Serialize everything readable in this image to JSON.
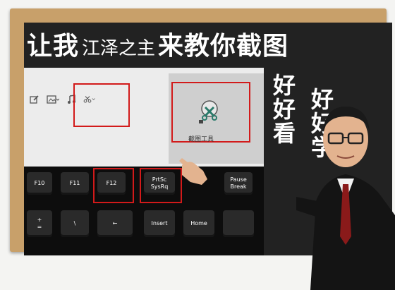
{
  "title": {
    "part1": "让我",
    "part2": "江泽之主",
    "part3": "来教你截图"
  },
  "side": {
    "left": "好好看",
    "right": "好好学"
  },
  "screenshot": {
    "breadcrumb": "",
    "tool_label": "截图工具"
  },
  "keys": {
    "f10": "F10",
    "f11": "F11",
    "f12": "F12",
    "prtsc_top": "PrtSc",
    "prtsc_bottom": "SysRq",
    "pause_top": "Pause",
    "pause_bottom": "Break",
    "plus": "+",
    "equals": "=",
    "backslash": "\\",
    "arrow_left": "←",
    "insert": "Insert",
    "home": "Home"
  },
  "colors": {
    "highlight": "#d21a1a",
    "frame": "#c8a06a",
    "board": "#222222"
  }
}
